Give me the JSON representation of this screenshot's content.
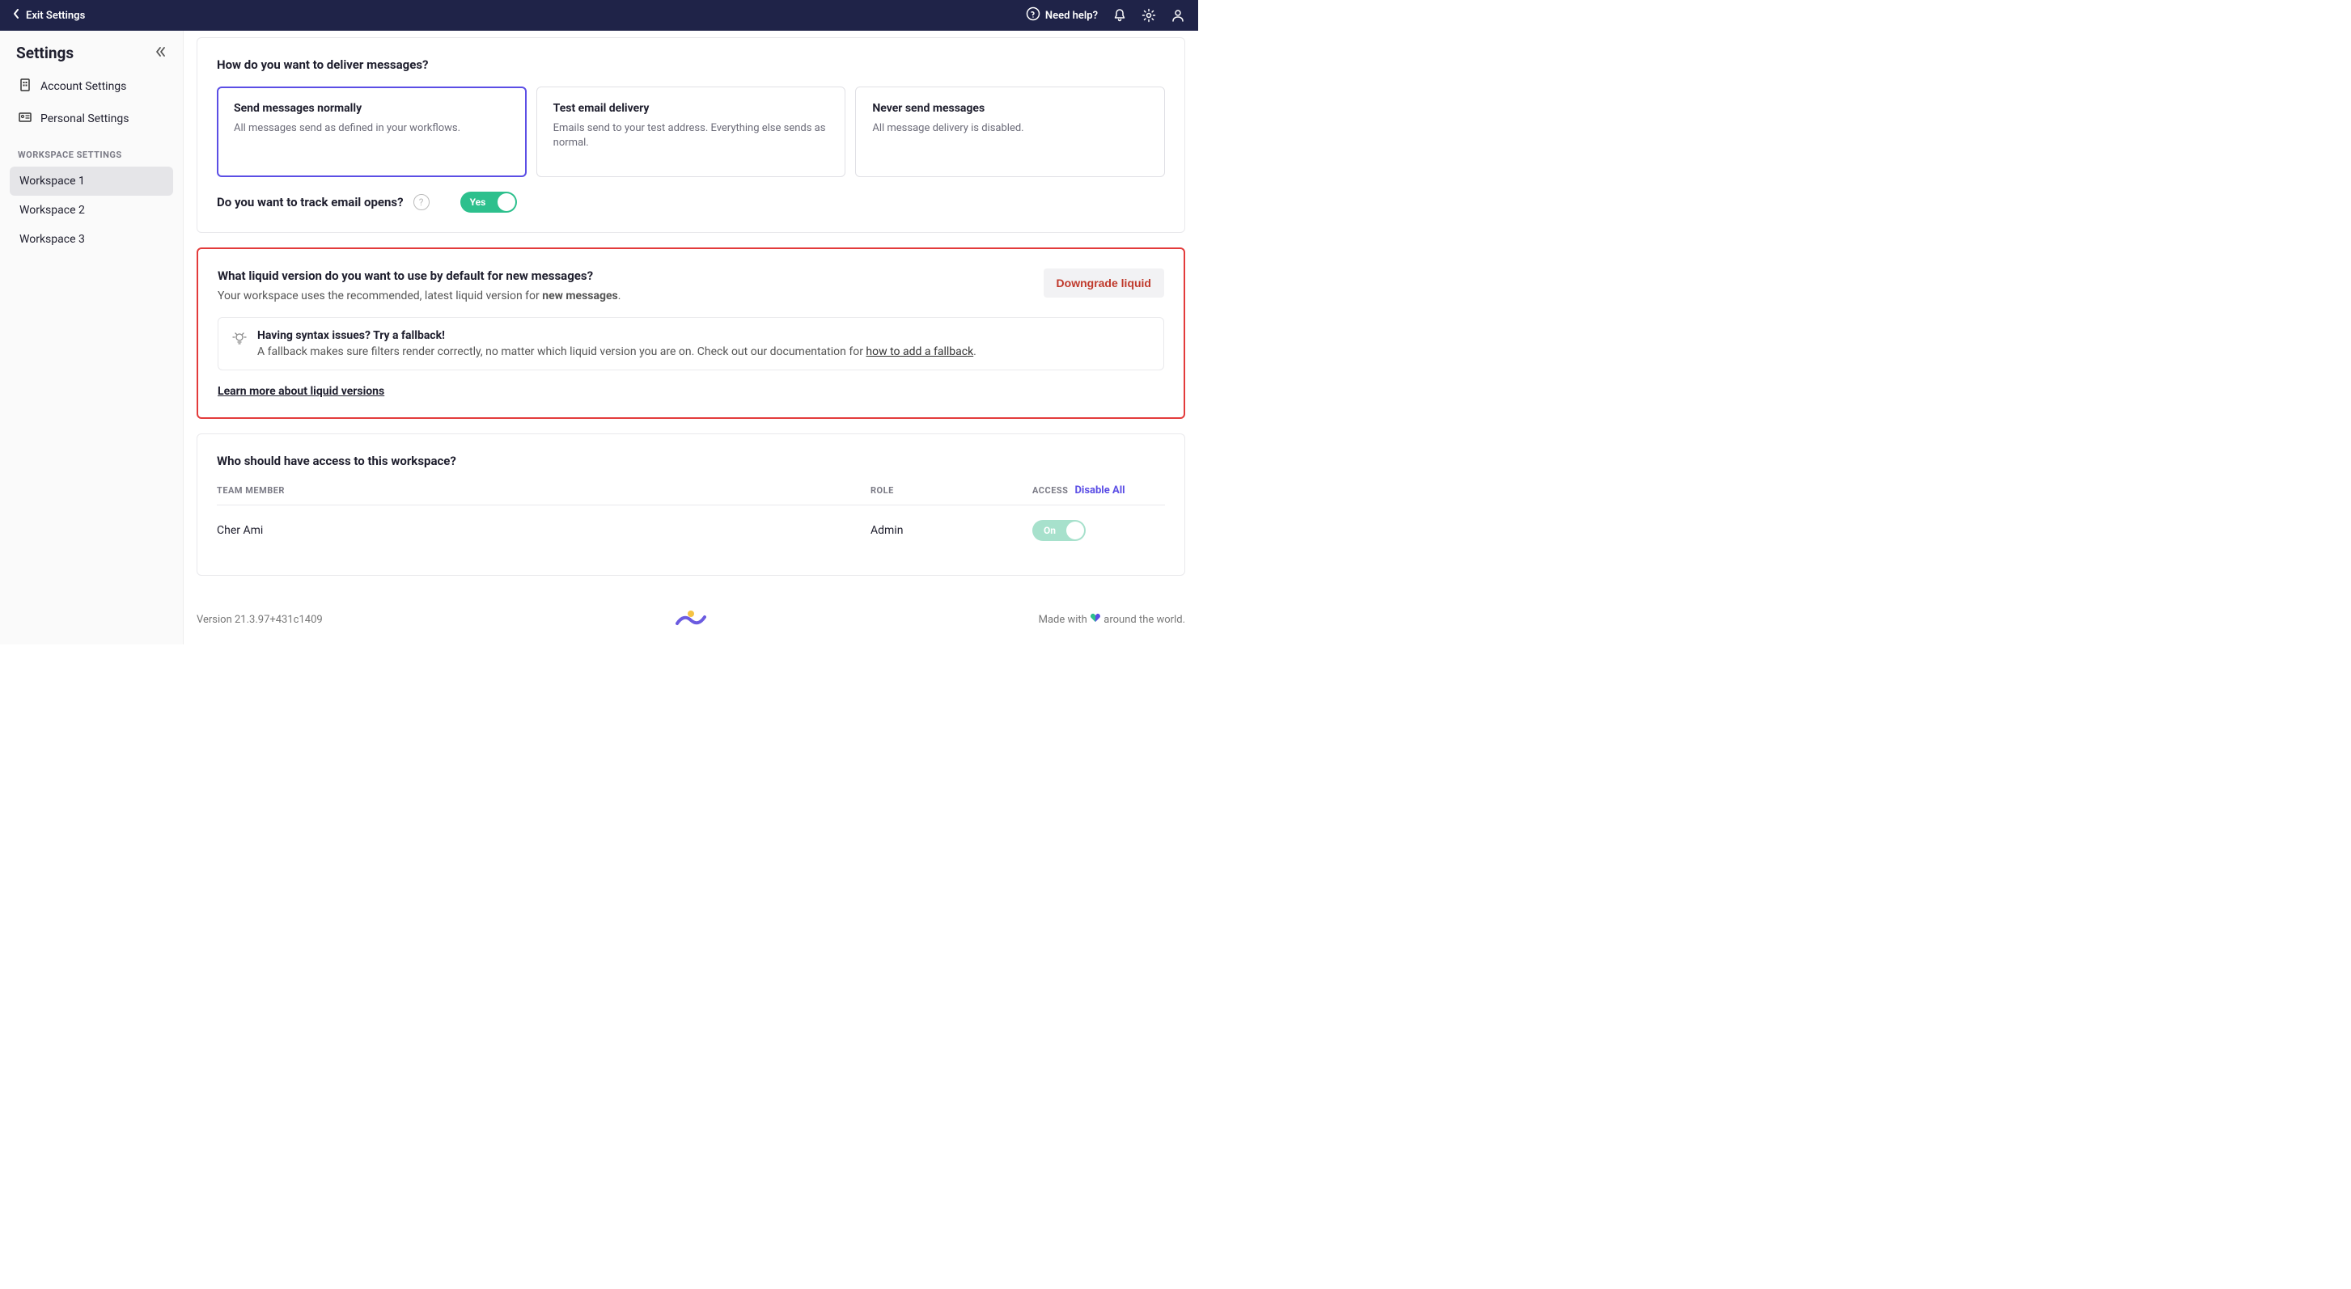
{
  "topbar": {
    "exit_label": "Exit Settings",
    "help_label": "Need help?"
  },
  "sidebar": {
    "title": "Settings",
    "nav": {
      "account": "Account Settings",
      "personal": "Personal Settings"
    },
    "section_label": "WORKSPACE SETTINGS",
    "workspaces": [
      "Workspace 1",
      "Workspace 2",
      "Workspace 3"
    ]
  },
  "delivery": {
    "title": "How do you want to deliver messages?",
    "options": [
      {
        "title": "Send messages normally",
        "desc": "All messages send as defined in your workflows."
      },
      {
        "title": "Test email delivery",
        "desc": "Emails send to your test address. Everything else sends as normal."
      },
      {
        "title": "Never send messages",
        "desc": "All message delivery is disabled."
      }
    ],
    "track_label": "Do you want to track email opens?",
    "track_toggle": "Yes"
  },
  "liquid": {
    "title": "What liquid version do you want to use by default for new messages?",
    "sub_prefix": "Your workspace uses the recommended, latest liquid version for ",
    "sub_bold": "new messages",
    "sub_suffix": ".",
    "downgrade_btn": "Downgrade liquid",
    "info_title": "Having syntax issues? Try a fallback!",
    "info_desc_prefix": "A fallback makes sure filters render correctly, no matter which liquid version you are on. Check out our documentation for ",
    "info_link": "how to add a fallback",
    "info_desc_suffix": ".",
    "learn_link": "Learn more about liquid versions"
  },
  "access": {
    "title": "Who should have access to this workspace?",
    "col_member": "TEAM MEMBER",
    "col_role": "ROLE",
    "col_access": "ACCESS",
    "disable_all": "Disable All",
    "rows": [
      {
        "name": "Cher Ami",
        "role": "Admin",
        "toggle": "On"
      }
    ]
  },
  "footer": {
    "version": "Version 21.3.97+431c1409",
    "made_prefix": "Made with ",
    "made_suffix": " around the world."
  }
}
